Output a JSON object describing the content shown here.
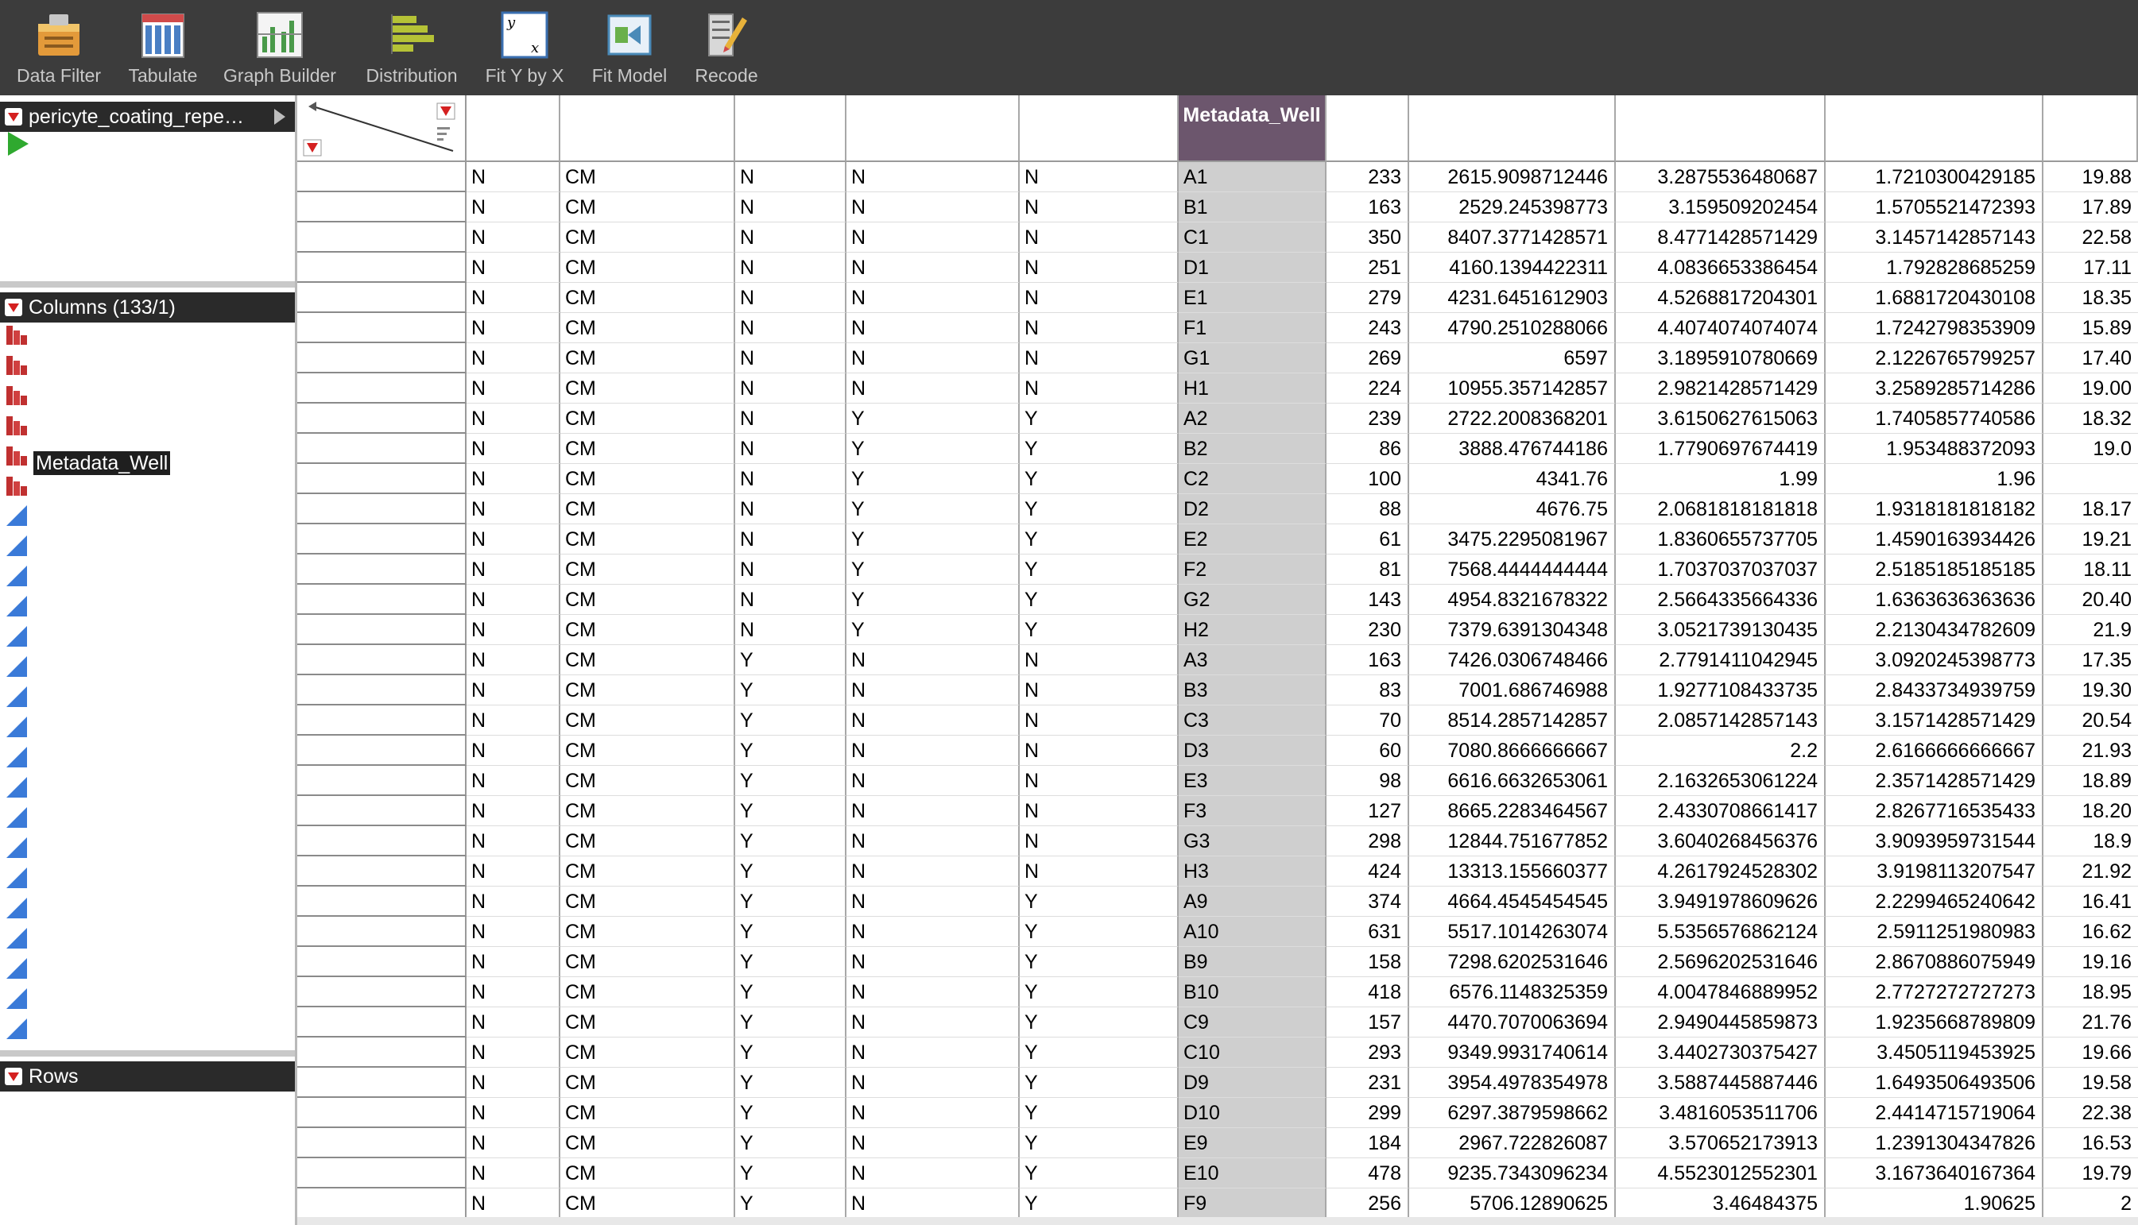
{
  "toolbar": {
    "items": [
      {
        "label": "Data Filter",
        "icon": "data-filter-icon"
      },
      {
        "label": "Tabulate",
        "icon": "tabulate-icon"
      },
      {
        "label": "Graph Builder",
        "icon": "graph-builder-icon"
      },
      {
        "label": "Distribution",
        "icon": "distribution-icon"
      },
      {
        "label": "Fit Y by X",
        "icon": "fit-y-by-x-icon"
      },
      {
        "label": "Fit Model",
        "icon": "fit-model-icon"
      },
      {
        "label": "Recode",
        "icon": "recode-icon"
      }
    ]
  },
  "left_panel": {
    "table_title": "pericyte_coating_repe…",
    "columns_header": "Columns (133/1)",
    "selected_column": "Metadata_Well",
    "rows_header": "Rows"
  },
  "grid": {
    "selected_header": "Metadata_Well",
    "rows": [
      [
        "N",
        "CM",
        "N",
        "N",
        "N",
        "A1",
        "233",
        "2615.9098712446",
        "3.2875536480687",
        "1.7210300429185",
        "19.88"
      ],
      [
        "N",
        "CM",
        "N",
        "N",
        "N",
        "B1",
        "163",
        "2529.245398773",
        "3.159509202454",
        "1.5705521472393",
        "17.89"
      ],
      [
        "N",
        "CM",
        "N",
        "N",
        "N",
        "C1",
        "350",
        "8407.3771428571",
        "8.4771428571429",
        "3.1457142857143",
        "22.58"
      ],
      [
        "N",
        "CM",
        "N",
        "N",
        "N",
        "D1",
        "251",
        "4160.1394422311",
        "4.0836653386454",
        "1.792828685259",
        "17.11"
      ],
      [
        "N",
        "CM",
        "N",
        "N",
        "N",
        "E1",
        "279",
        "4231.6451612903",
        "4.5268817204301",
        "1.6881720430108",
        "18.35"
      ],
      [
        "N",
        "CM",
        "N",
        "N",
        "N",
        "F1",
        "243",
        "4790.2510288066",
        "4.4074074074074",
        "1.7242798353909",
        "15.89"
      ],
      [
        "N",
        "CM",
        "N",
        "N",
        "N",
        "G1",
        "269",
        "6597",
        "3.1895910780669",
        "2.1226765799257",
        "17.40"
      ],
      [
        "N",
        "CM",
        "N",
        "N",
        "N",
        "H1",
        "224",
        "10955.357142857",
        "2.9821428571429",
        "3.2589285714286",
        "19.00"
      ],
      [
        "N",
        "CM",
        "N",
        "Y",
        "Y",
        "A2",
        "239",
        "2722.2008368201",
        "3.6150627615063",
        "1.7405857740586",
        "18.32"
      ],
      [
        "N",
        "CM",
        "N",
        "Y",
        "Y",
        "B2",
        "86",
        "3888.476744186",
        "1.7790697674419",
        "1.953488372093",
        "19.0"
      ],
      [
        "N",
        "CM",
        "N",
        "Y",
        "Y",
        "C2",
        "100",
        "4341.76",
        "1.99",
        "1.96",
        ""
      ],
      [
        "N",
        "CM",
        "N",
        "Y",
        "Y",
        "D2",
        "88",
        "4676.75",
        "2.0681818181818",
        "1.9318181818182",
        "18.17"
      ],
      [
        "N",
        "CM",
        "N",
        "Y",
        "Y",
        "E2",
        "61",
        "3475.2295081967",
        "1.8360655737705",
        "1.4590163934426",
        "19.21"
      ],
      [
        "N",
        "CM",
        "N",
        "Y",
        "Y",
        "F2",
        "81",
        "7568.4444444444",
        "1.7037037037037",
        "2.5185185185185",
        "18.11"
      ],
      [
        "N",
        "CM",
        "N",
        "Y",
        "Y",
        "G2",
        "143",
        "4954.8321678322",
        "2.5664335664336",
        "1.6363636363636",
        "20.40"
      ],
      [
        "N",
        "CM",
        "N",
        "Y",
        "Y",
        "H2",
        "230",
        "7379.6391304348",
        "3.0521739130435",
        "2.2130434782609",
        "21.9"
      ],
      [
        "N",
        "CM",
        "Y",
        "N",
        "N",
        "A3",
        "163",
        "7426.0306748466",
        "2.7791411042945",
        "3.0920245398773",
        "17.35"
      ],
      [
        "N",
        "CM",
        "Y",
        "N",
        "N",
        "B3",
        "83",
        "7001.686746988",
        "1.9277108433735",
        "2.8433734939759",
        "19.30"
      ],
      [
        "N",
        "CM",
        "Y",
        "N",
        "N",
        "C3",
        "70",
        "8514.2857142857",
        "2.0857142857143",
        "3.1571428571429",
        "20.54"
      ],
      [
        "N",
        "CM",
        "Y",
        "N",
        "N",
        "D3",
        "60",
        "7080.8666666667",
        "2.2",
        "2.6166666666667",
        "21.93"
      ],
      [
        "N",
        "CM",
        "Y",
        "N",
        "N",
        "E3",
        "98",
        "6616.6632653061",
        "2.1632653061224",
        "2.3571428571429",
        "18.89"
      ],
      [
        "N",
        "CM",
        "Y",
        "N",
        "N",
        "F3",
        "127",
        "8665.2283464567",
        "2.4330708661417",
        "2.8267716535433",
        "18.20"
      ],
      [
        "N",
        "CM",
        "Y",
        "N",
        "N",
        "G3",
        "298",
        "12844.751677852",
        "3.6040268456376",
        "3.9093959731544",
        "18.9"
      ],
      [
        "N",
        "CM",
        "Y",
        "N",
        "N",
        "H3",
        "424",
        "13313.155660377",
        "4.2617924528302",
        "3.9198113207547",
        "21.92"
      ],
      [
        "N",
        "CM",
        "Y",
        "N",
        "Y",
        "A9",
        "374",
        "4664.4545454545",
        "3.9491978609626",
        "2.2299465240642",
        "16.41"
      ],
      [
        "N",
        "CM",
        "Y",
        "N",
        "Y",
        "A10",
        "631",
        "5517.1014263074",
        "5.5356576862124",
        "2.5911251980983",
        "16.62"
      ],
      [
        "N",
        "CM",
        "Y",
        "N",
        "Y",
        "B9",
        "158",
        "7298.6202531646",
        "2.5696202531646",
        "2.8670886075949",
        "19.16"
      ],
      [
        "N",
        "CM",
        "Y",
        "N",
        "Y",
        "B10",
        "418",
        "6576.1148325359",
        "4.0047846889952",
        "2.7727272727273",
        "18.95"
      ],
      [
        "N",
        "CM",
        "Y",
        "N",
        "Y",
        "C9",
        "157",
        "4470.7070063694",
        "2.9490445859873",
        "1.9235668789809",
        "21.76"
      ],
      [
        "N",
        "CM",
        "Y",
        "N",
        "Y",
        "C10",
        "293",
        "9349.9931740614",
        "3.4402730375427",
        "3.4505119453925",
        "19.66"
      ],
      [
        "N",
        "CM",
        "Y",
        "N",
        "Y",
        "D9",
        "231",
        "3954.4978354978",
        "3.5887445887446",
        "1.6493506493506",
        "19.58"
      ],
      [
        "N",
        "CM",
        "Y",
        "N",
        "Y",
        "D10",
        "299",
        "6297.3879598662",
        "3.4816053511706",
        "2.4414715719064",
        "22.38"
      ],
      [
        "N",
        "CM",
        "Y",
        "N",
        "Y",
        "E9",
        "184",
        "2967.722826087",
        "3.570652173913",
        "1.2391304347826",
        "16.53"
      ],
      [
        "N",
        "CM",
        "Y",
        "N",
        "Y",
        "E10",
        "478",
        "9235.7343096234",
        "4.5523012552301",
        "3.1673640167364",
        "19.79"
      ],
      [
        "N",
        "CM",
        "Y",
        "N",
        "Y",
        "F9",
        "256",
        "5706.12890625",
        "3.46484375",
        "1.90625",
        "2"
      ]
    ]
  }
}
